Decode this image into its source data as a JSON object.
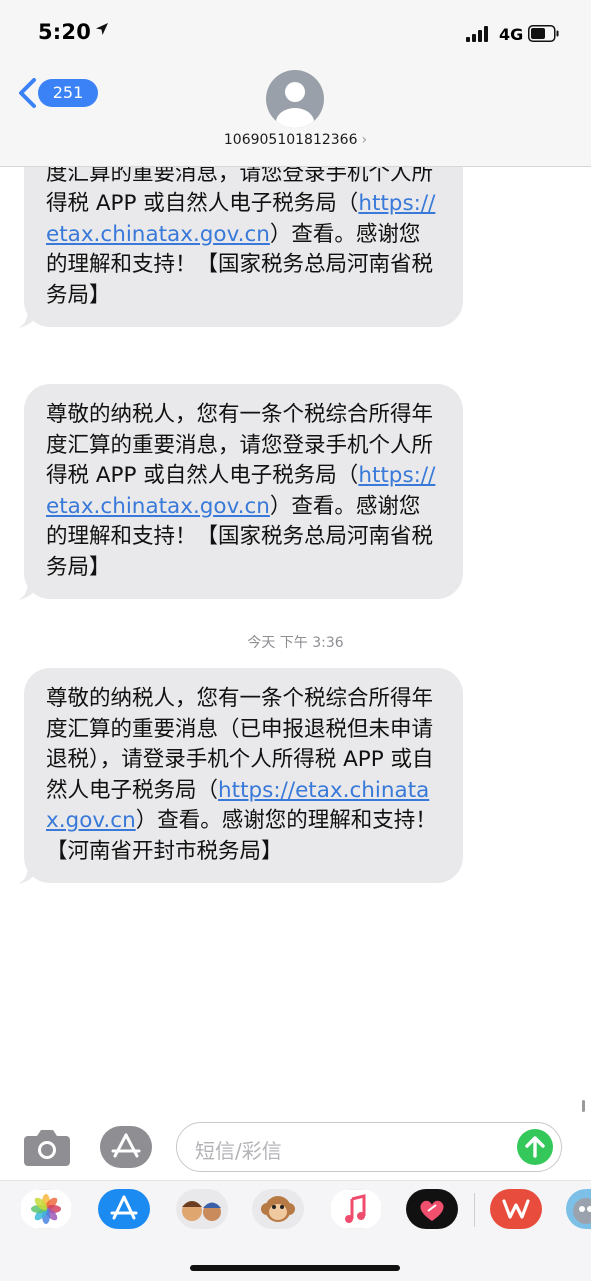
{
  "status": {
    "time": "5:20",
    "network": "4G"
  },
  "header": {
    "back_badge": "251",
    "contact": "106905101812366",
    "contact_chevron": "›"
  },
  "messages": [
    {
      "before": "尊敬的纳税人，您有一条个税综合所得年度汇算的重要消息，请您登录手机个人所得税 APP 或自然人电子税务局（",
      "link": "https://etax.chinatax.gov.cn",
      "after": "）查看。感谢您的理解和支持！【国家税务总局河南省税务局】"
    },
    {
      "before": "尊敬的纳税人，您有一条个税综合所得年度汇算的重要消息，请您登录手机个人所得税 APP 或自然人电子税务局（",
      "link": "https://etax.chinatax.gov.cn",
      "after": "）查看。感谢您的理解和支持！【国家税务总局河南省税务局】"
    },
    {
      "before": "尊敬的纳税人，您有一条个税综合所得年度汇算的重要消息（已申报退税但未申请退税），请登录手机个人所得税 APP 或自然人电子税务局（",
      "link": "https://etax.chinatax.gov.cn",
      "after": "）查看。感谢您的理解和支持！【河南省开封市税务局】"
    }
  ],
  "timestamp": "今天 下午 3:36",
  "composer": {
    "placeholder": "短信/彩信"
  },
  "icons": {
    "camera": "camera-icon",
    "appstore": "appstore-icon",
    "send": "send-arrow-icon"
  },
  "app_strip": [
    "Photos",
    "App Store",
    "Memoji",
    "Animoji",
    "Music",
    "Digital Touch",
    "WPS",
    "Talking Tom"
  ],
  "colors": {
    "accent": "#3a82f6",
    "bubble": "#e9e9eb",
    "link": "#3879d9",
    "send": "#34c759"
  }
}
